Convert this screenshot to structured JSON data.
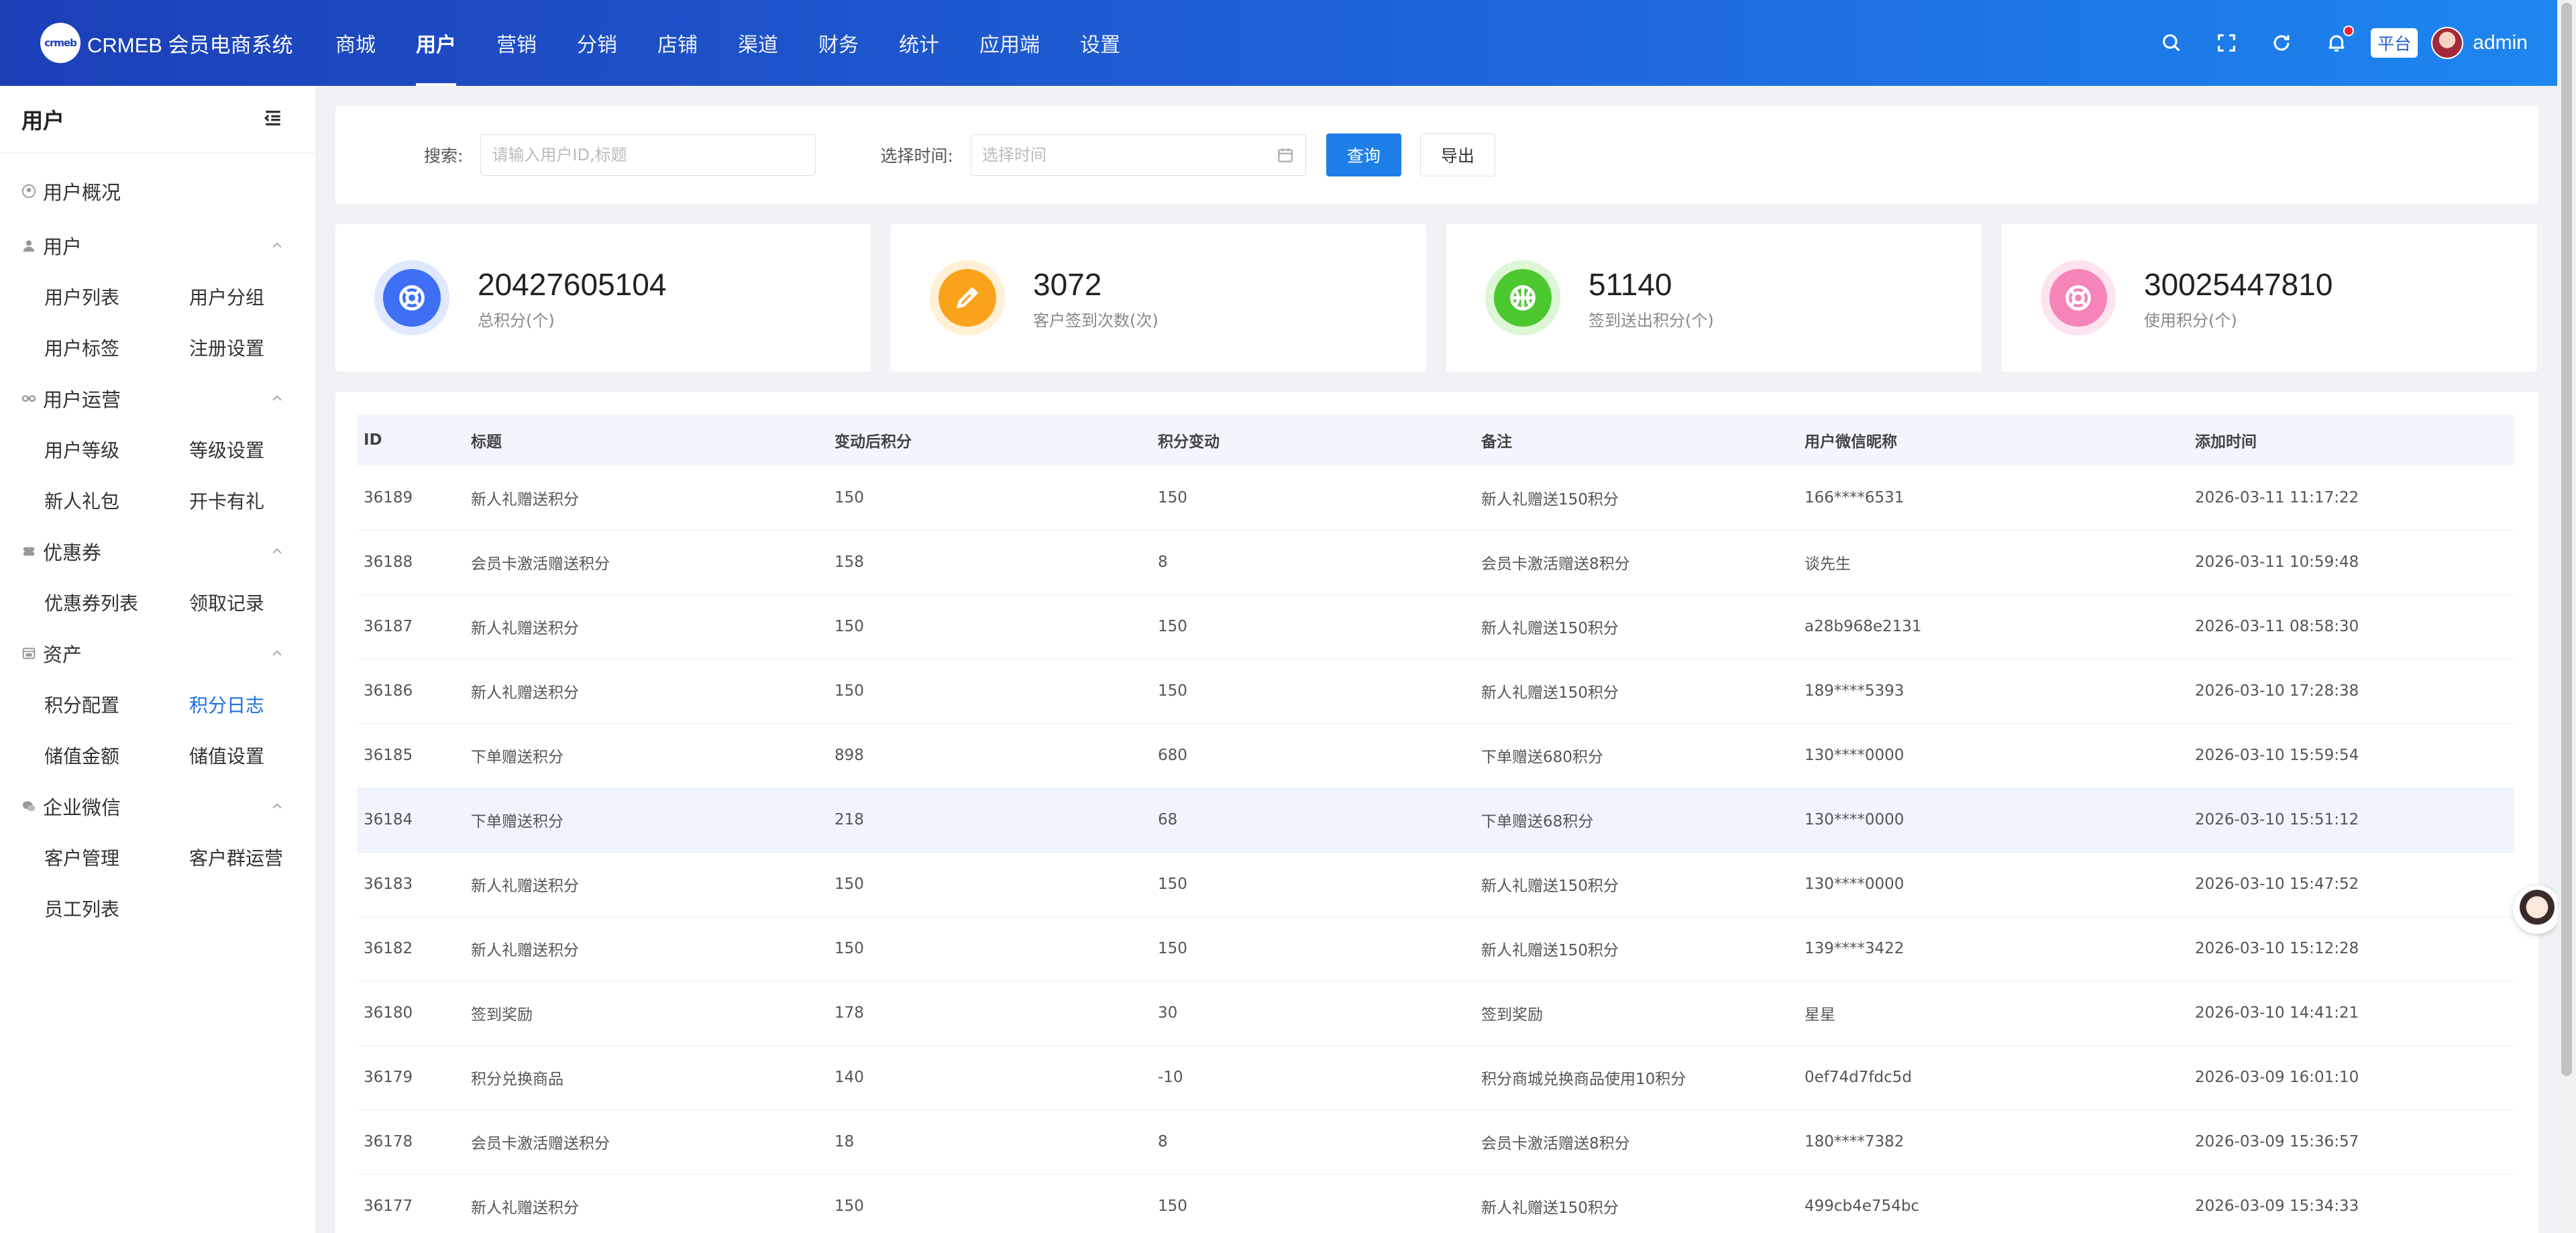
{
  "brand": {
    "logo_mark": "crmeb",
    "name": "CRMEB 会员电商系统"
  },
  "nav": [
    "商城",
    "用户",
    "营销",
    "分销",
    "店铺",
    "渠道",
    "财务",
    "统计",
    "应用端",
    "设置"
  ],
  "header": {
    "platform": "平台",
    "user": "admin"
  },
  "sidebar": {
    "title": "用户",
    "overview": "用户概况",
    "groups": [
      {
        "label": "用户",
        "items": [
          "用户列表",
          "用户分组",
          "用户标签",
          "注册设置"
        ]
      },
      {
        "label": "用户运营",
        "items": [
          "用户等级",
          "等级设置",
          "新人礼包",
          "开卡有礼"
        ]
      },
      {
        "label": "优惠券",
        "items": [
          "优惠券列表",
          "领取记录"
        ]
      },
      {
        "label": "资产",
        "items": [
          "积分配置",
          "积分日志",
          "储值金额",
          "储值设置"
        ]
      },
      {
        "label": "企业微信",
        "items": [
          "客户管理",
          "客户群运营",
          "员工列表"
        ]
      }
    ]
  },
  "search": {
    "label": "搜索:",
    "placeholder": "请输入用户ID,标题",
    "time_label": "选择时间:",
    "time_placeholder": "选择时间",
    "query_btn": "查询",
    "export_btn": "导出"
  },
  "stats": [
    {
      "value": "20427605104",
      "label": "总积分(个)",
      "color": "#3e6ff5",
      "ring": "#dfe8ff"
    },
    {
      "value": "3072",
      "label": "客户签到次数(次)",
      "color": "#fba21b",
      "ring": "#fff0d6"
    },
    {
      "value": "51140",
      "label": "签到送出积分(个)",
      "color": "#4cc82f",
      "ring": "#ddf6d5"
    },
    {
      "value": "30025447810",
      "label": "使用积分(个)",
      "color": "#f684b8",
      "ring": "#fde3ef"
    }
  ],
  "table": {
    "headers": [
      "ID",
      "标题",
      "变动后积分",
      "积分变动",
      "备注",
      "用户微信昵称",
      "添加时间"
    ],
    "rows": [
      [
        "36189",
        "新人礼赠送积分",
        "150",
        "150",
        "新人礼赠送150积分",
        "166****6531",
        "2026-03-11 11:17:22"
      ],
      [
        "36188",
        "会员卡激活赠送积分",
        "158",
        "8",
        "会员卡激活赠送8积分",
        "谈先生",
        "2026-03-11 10:59:48"
      ],
      [
        "36187",
        "新人礼赠送积分",
        "150",
        "150",
        "新人礼赠送150积分",
        "a28b968e2131",
        "2026-03-11 08:58:30"
      ],
      [
        "36186",
        "新人礼赠送积分",
        "150",
        "150",
        "新人礼赠送150积分",
        "189****5393",
        "2026-03-10 17:28:38"
      ],
      [
        "36185",
        "下单赠送积分",
        "898",
        "680",
        "下单赠送680积分",
        "130****0000",
        "2026-03-10 15:59:54"
      ],
      [
        "36184",
        "下单赠送积分",
        "218",
        "68",
        "下单赠送68积分",
        "130****0000",
        "2026-03-10 15:51:12"
      ],
      [
        "36183",
        "新人礼赠送积分",
        "150",
        "150",
        "新人礼赠送150积分",
        "130****0000",
        "2026-03-10 15:47:52"
      ],
      [
        "36182",
        "新人礼赠送积分",
        "150",
        "150",
        "新人礼赠送150积分",
        "139****3422",
        "2026-03-10 15:12:28"
      ],
      [
        "36180",
        "签到奖励",
        "178",
        "30",
        "签到奖励",
        "星星",
        "2026-03-10 14:41:21"
      ],
      [
        "36179",
        "积分兑换商品",
        "140",
        "-10",
        "积分商城兑换商品使用10积分",
        "0ef74d7fdc5d",
        "2026-03-09 16:01:10"
      ],
      [
        "36178",
        "会员卡激活赠送积分",
        "18",
        "8",
        "会员卡激活赠送8积分",
        "180****7382",
        "2026-03-09 15:36:57"
      ],
      [
        "36177",
        "新人礼赠送积分",
        "150",
        "150",
        "新人礼赠送150积分",
        "499cb4e754bc",
        "2026-03-09 15:34:33"
      ]
    ]
  }
}
